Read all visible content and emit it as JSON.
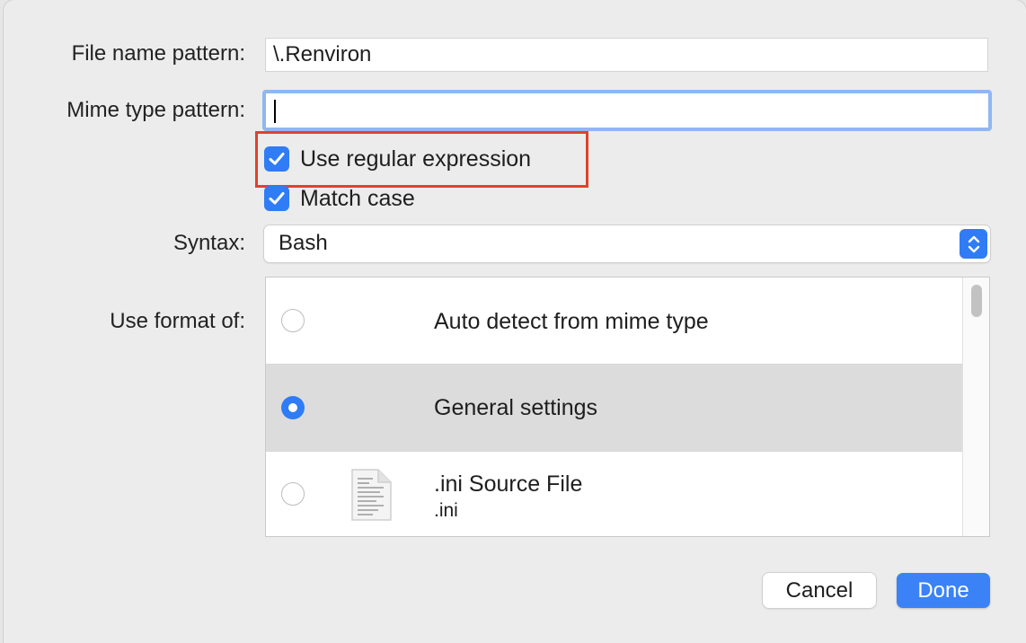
{
  "form": {
    "file_name_label": "File name pattern:",
    "file_name_value": "\\.Renviron",
    "mime_type_label": "Mime type pattern:",
    "mime_type_value": "",
    "use_regex_label": "Use regular expression",
    "use_regex_checked": true,
    "match_case_label": "Match case",
    "match_case_checked": true,
    "syntax_label": "Syntax:",
    "syntax_value": "Bash",
    "use_format_label": "Use format of:"
  },
  "format_list": {
    "items": [
      {
        "title": "Auto detect from mime type",
        "subtitle": "",
        "selected": false,
        "icon": "none"
      },
      {
        "title": "General settings",
        "subtitle": "",
        "selected": true,
        "icon": "none"
      },
      {
        "title": ".ini Source File",
        "subtitle": ".ini",
        "selected": false,
        "icon": "document-icon"
      }
    ]
  },
  "buttons": {
    "cancel_label": "Cancel",
    "done_label": "Done"
  },
  "colors": {
    "accent": "#2f7cf6",
    "highlight": "#e0422b"
  }
}
